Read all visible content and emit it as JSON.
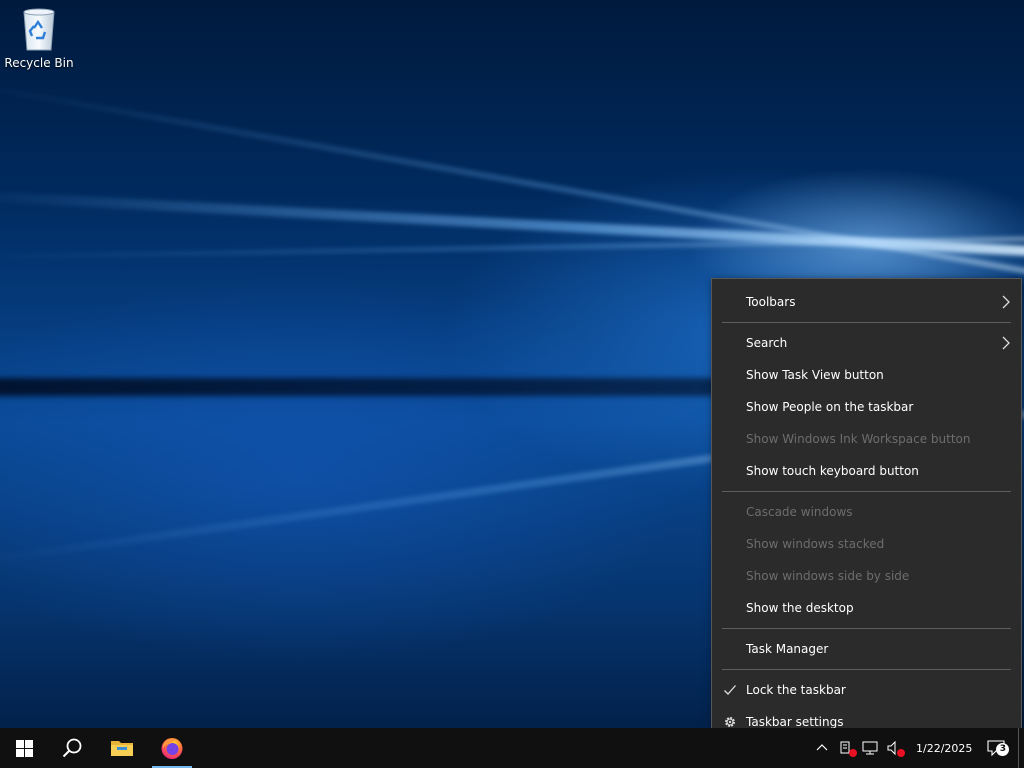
{
  "desktop": {
    "icons": [
      {
        "label": "Recycle Bin",
        "icon": "recycle-bin-icon"
      }
    ]
  },
  "taskbar": {
    "buttons": [
      {
        "name": "start",
        "icon": "windows-logo-icon"
      },
      {
        "name": "search",
        "icon": "search-icon"
      },
      {
        "name": "file-explorer",
        "icon": "folder-icon"
      },
      {
        "name": "firefox",
        "icon": "firefox-icon",
        "active": true
      }
    ],
    "tray": {
      "icons": [
        "chevron-up-icon",
        "printer-error-icon",
        "network-icon",
        "volume-muted-icon"
      ],
      "date": "1/22/2025",
      "notification_count": "3"
    }
  },
  "context_menu": {
    "items": [
      {
        "label": "Toolbars",
        "enabled": true,
        "submenu": true
      },
      {
        "separator": true
      },
      {
        "label": "Search",
        "enabled": true,
        "submenu": true
      },
      {
        "label": "Show Task View button",
        "enabled": true
      },
      {
        "label": "Show People on the taskbar",
        "enabled": true
      },
      {
        "label": "Show Windows Ink Workspace button",
        "enabled": false
      },
      {
        "label": "Show touch keyboard button",
        "enabled": true
      },
      {
        "separator": true
      },
      {
        "label": "Cascade windows",
        "enabled": false
      },
      {
        "label": "Show windows stacked",
        "enabled": false
      },
      {
        "label": "Show windows side by side",
        "enabled": false
      },
      {
        "label": "Show the desktop",
        "enabled": true
      },
      {
        "separator": true
      },
      {
        "label": "Task Manager",
        "enabled": true
      },
      {
        "separator": true
      },
      {
        "label": "Lock the taskbar",
        "enabled": true,
        "checked": true,
        "icon": "checkmark-icon"
      },
      {
        "label": "Taskbar settings",
        "enabled": true,
        "icon": "gear-icon"
      }
    ]
  },
  "colors": {
    "menu_bg": "#2b2b2b",
    "menu_disabled": "#6d6d6d",
    "taskbar_bg": "#101010",
    "active_indicator": "#76b9ed"
  }
}
